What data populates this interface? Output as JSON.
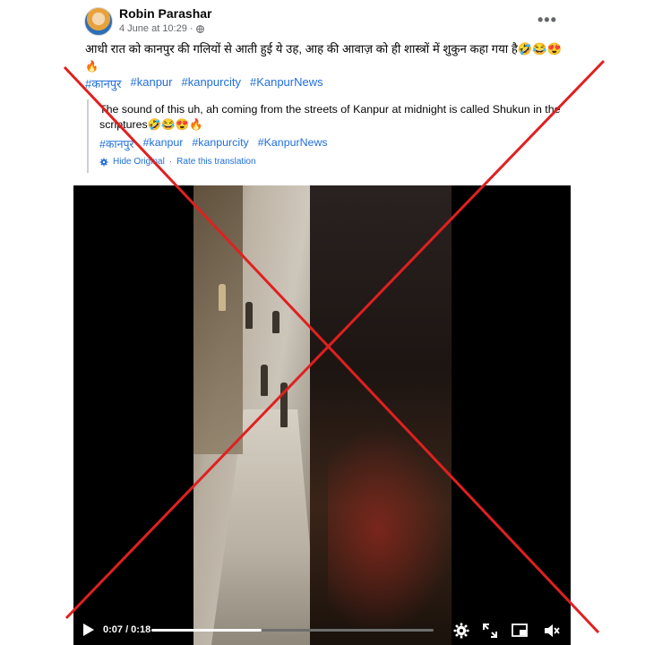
{
  "post": {
    "author": "Robin Parashar",
    "date": "4 June at 10:29",
    "separator": "·",
    "text": "आधी रात को कानपुर की गलियों से आती हुई ये उह, आह की आवाज़ को ही शास्त्रों में शुकुन कहा गया है🤣😂😍",
    "text_fire": "🔥",
    "hashtags": [
      "#कानपुर",
      "#kanpur",
      "#kanpurcity",
      "#KanpurNews"
    ],
    "more_icon": "more-options-icon"
  },
  "translation": {
    "text": "The sound of this uh, ah coming from the streets of Kanpur at midnight is called Shukun in the scriptures🤣😂😍🔥",
    "hashtags": [
      "#कानपुर",
      "#kanpur",
      "#kanpurcity",
      "#KanpurNews"
    ],
    "hide_original": "Hide Original",
    "dot": "·",
    "rate": "Rate this translation"
  },
  "video": {
    "current_time": "0:07",
    "duration": "0:18",
    "time_display": "0:07 / 0:18",
    "progress": 0.39
  },
  "overlay": {
    "cross_color": "#e02020"
  },
  "colors": {
    "link": "#216fdb",
    "secondary_text": "#65676b"
  }
}
